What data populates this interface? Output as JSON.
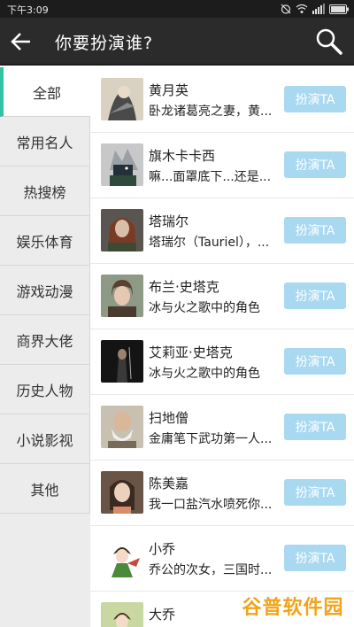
{
  "status_bar": {
    "time": "下午3:09",
    "icons": [
      "alarm-off-icon",
      "wifi-icon",
      "signal-icon",
      "battery-icon"
    ]
  },
  "app_bar": {
    "title": "你要扮演谁?",
    "icons": [
      "back-arrow-icon",
      "search-icon"
    ]
  },
  "sidebar": {
    "active_index": 0,
    "items": [
      "全部",
      "常用名人",
      "热搜榜",
      "娱乐体育",
      "游戏动漫",
      "商界大佬",
      "历史人物",
      "小说影视",
      "其他"
    ]
  },
  "list": {
    "button_label": "扮演TA",
    "items": [
      {
        "name": "黄月英",
        "desc": "卧龙诸葛亮之妻，黄..."
      },
      {
        "name": "旗木卡卡西",
        "desc": "嘛...面罩底下...还是..."
      },
      {
        "name": "塔瑞尔",
        "desc": "塔瑞尔（Tauriel），..."
      },
      {
        "name": "布兰·史塔克",
        "desc": "冰与火之歌中的角色"
      },
      {
        "name": "艾莉亚·史塔克",
        "desc": "冰与火之歌中的角色"
      },
      {
        "name": "扫地僧",
        "desc": "金庸笔下武功第一人..."
      },
      {
        "name": "陈美嘉",
        "desc": "我一口盐汽水喷死你..."
      },
      {
        "name": "小乔",
        "desc": "乔公的次女，三国时..."
      },
      {
        "name": "大乔",
        "desc": ""
      }
    ]
  },
  "watermark": "谷普软件园",
  "colors": {
    "accent": "#33c3a4",
    "button_bg": "#a9d9f0",
    "app_bar_bg": "#2b2b2b",
    "status_bar_bg": "#1c1c1c",
    "sidebar_bg": "#ececec",
    "watermark": "#f0a41c"
  }
}
